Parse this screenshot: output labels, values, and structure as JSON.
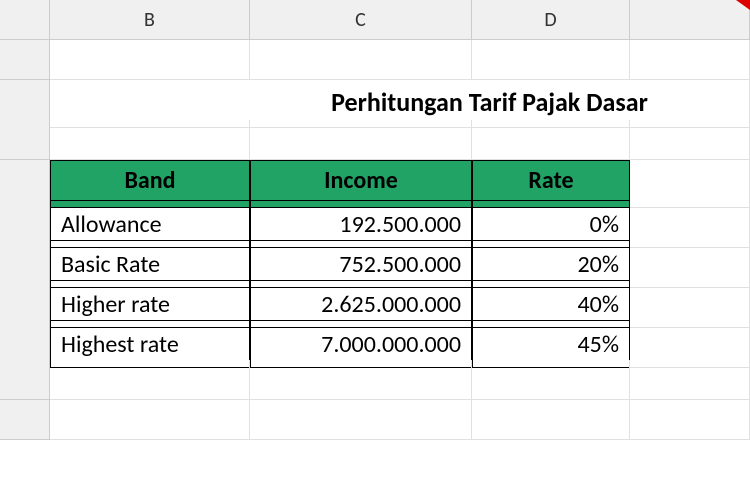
{
  "columns": [
    "B",
    "C",
    "D"
  ],
  "title": "Perhitungan Tarif Pajak Dasar",
  "headers": {
    "band": "Band",
    "income": "Income",
    "rate": "Rate"
  },
  "rows": [
    {
      "band": "Allowance",
      "income": "192.500.000",
      "rate": "0%"
    },
    {
      "band": "Basic Rate",
      "income": "752.500.000",
      "rate": "20%"
    },
    {
      "band": "Higher rate",
      "income": "2.625.000.000",
      "rate": "40%"
    },
    {
      "band": "Highest rate",
      "income": "7.000.000.000",
      "rate": "45%"
    }
  ]
}
